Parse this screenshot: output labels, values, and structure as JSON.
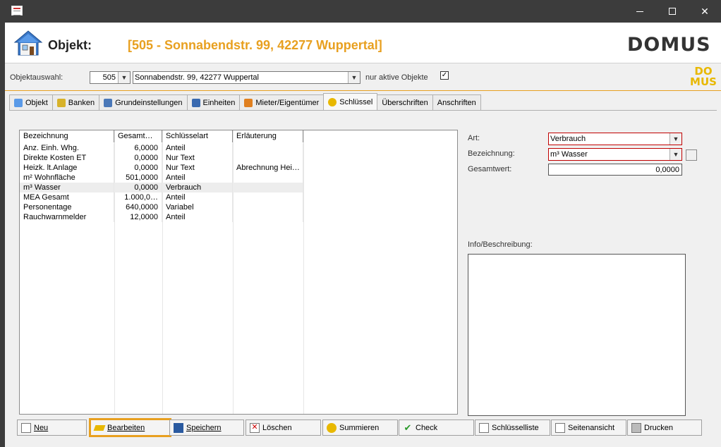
{
  "header": {
    "objekt_label": "Objekt:",
    "objekt_title": "[505 - Sonnabendstr. 99, 42277 Wuppertal]",
    "logo_text": "DOMUS"
  },
  "selector": {
    "label": "Objektauswahl:",
    "number": "505",
    "address": "Sonnabendstr. 99, 42277 Wuppertal",
    "aktive_label": "nur aktive Objekte",
    "aktive_checked": "✓",
    "small_logo_line1": "DO",
    "small_logo_line2": "MUS"
  },
  "tabs": [
    {
      "label": "Objekt",
      "icon": "house-icon"
    },
    {
      "label": "Banken",
      "icon": "bank-icon"
    },
    {
      "label": "Grundeinstellungen",
      "icon": "settings-icon"
    },
    {
      "label": "Einheiten",
      "icon": "units-icon"
    },
    {
      "label": "Mieter/Eigentümer",
      "icon": "people-icon"
    },
    {
      "label": "Schlüssel",
      "icon": "key-icon"
    },
    {
      "label": "Überschriften",
      "icon": ""
    },
    {
      "label": "Anschriften",
      "icon": ""
    }
  ],
  "grid": {
    "columns": [
      "Bezeichnung",
      "Gesamt…",
      "Schlüsselart",
      "Erläuterung"
    ],
    "rows": [
      [
        "Anz. Einh. Whg.",
        "6,0000",
        "Anteil",
        ""
      ],
      [
        "Direkte Kosten ET",
        "0,0000",
        "Nur Text",
        ""
      ],
      [
        "Heizk. lt.Anlage",
        "0,0000",
        "Nur Text",
        "Abrechnung Hei…"
      ],
      [
        "m² Wohnfläche",
        "501,0000",
        "Anteil",
        ""
      ],
      [
        "m³ Wasser",
        "0,0000",
        "Verbrauch",
        ""
      ],
      [
        "MEA Gesamt",
        "1.000,0…",
        "Anteil",
        ""
      ],
      [
        "Personentage",
        "640,0000",
        "Variabel",
        ""
      ],
      [
        "Rauchwarnmelder",
        "12,0000",
        "Anteil",
        ""
      ]
    ]
  },
  "details": {
    "art_label": "Art:",
    "art_value": "Verbrauch",
    "bezeichnung_label": "Bezeichnung:",
    "bezeichnung_value": "m³ Wasser",
    "gesamtwert_label": "Gesamtwert:",
    "gesamtwert_value": "0,0000",
    "info_label": "Info/Beschreibung:"
  },
  "buttons": {
    "neu": "Neu",
    "bearbeiten": "Bearbeiten",
    "speichern": "Speichern",
    "loeschen": "Löschen",
    "summieren": "Summieren",
    "check": "Check",
    "schluesselliste": "Schlüsselliste",
    "seitenansicht": "Seitenansicht",
    "drucken": "Drucken"
  },
  "colors": {
    "accent": "#e8a020",
    "required_border": "#c00000"
  }
}
